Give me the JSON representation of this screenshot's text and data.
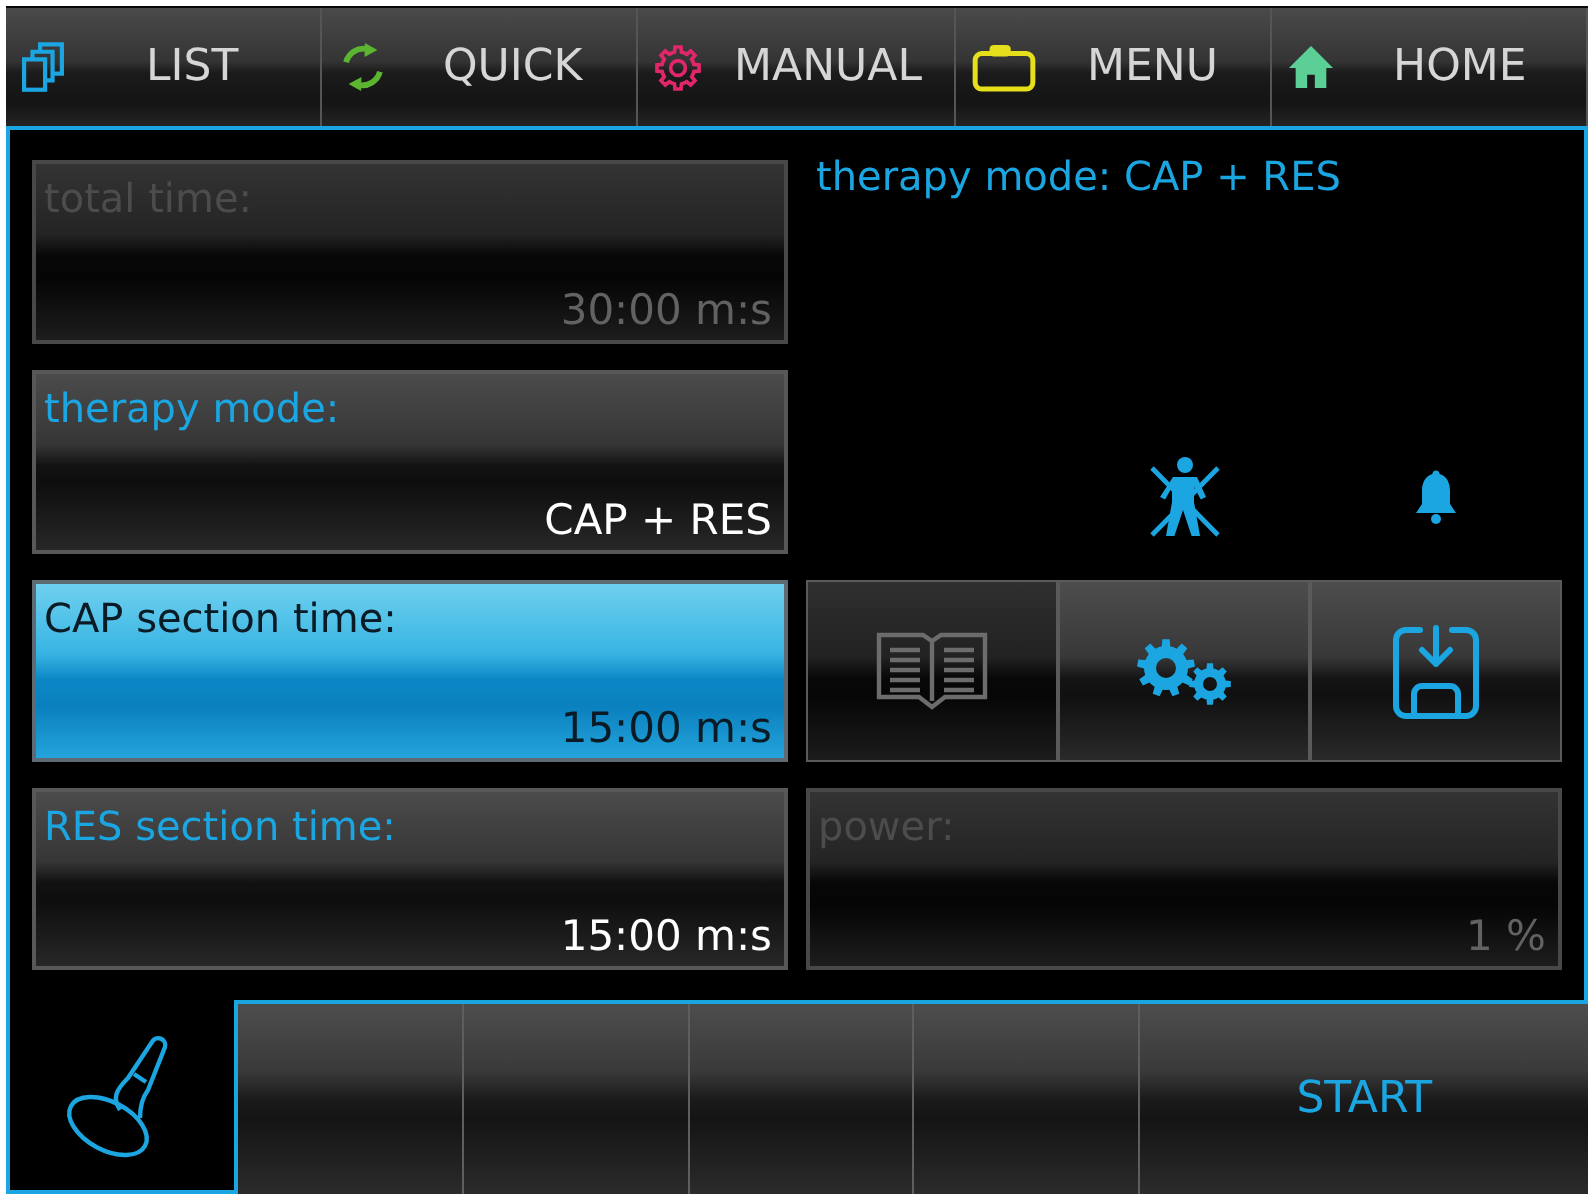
{
  "top_nav": {
    "items": [
      {
        "kind": "list",
        "label": "LIST"
      },
      {
        "kind": "quick",
        "label": "QUICK"
      },
      {
        "kind": "manual",
        "label": "MANUAL"
      },
      {
        "kind": "menu",
        "label": "MENU"
      },
      {
        "kind": "home",
        "label": "HOME"
      }
    ]
  },
  "fields": [
    {
      "label": "total time:",
      "value": "30:00 m:s",
      "selected": false,
      "disabled": true
    },
    {
      "label": "therapy mode:",
      "value": "CAP + RES",
      "selected": false,
      "disabled": false
    },
    {
      "label": "CAP section time:",
      "value": "15:00 m:s",
      "selected": true,
      "disabled": false
    },
    {
      "label": "RES section time:",
      "value": "15:00 m:s",
      "selected": false,
      "disabled": false
    }
  ],
  "right_panel": {
    "status_text": "therapy mode: CAP + RES",
    "tool_buttons": [
      {
        "kind": "manual",
        "disabled": true
      },
      {
        "kind": "settings",
        "disabled": false
      },
      {
        "kind": "save",
        "disabled": false
      }
    ],
    "power": {
      "label": "power:",
      "value": "1 %",
      "selected": false,
      "disabled": true
    }
  },
  "soft_keys": [
    {
      "kind": "blank"
    },
    {
      "kind": "blank"
    },
    {
      "kind": "blank"
    },
    {
      "kind": "blank"
    },
    {
      "kind": "start",
      "label": "START"
    }
  ]
}
